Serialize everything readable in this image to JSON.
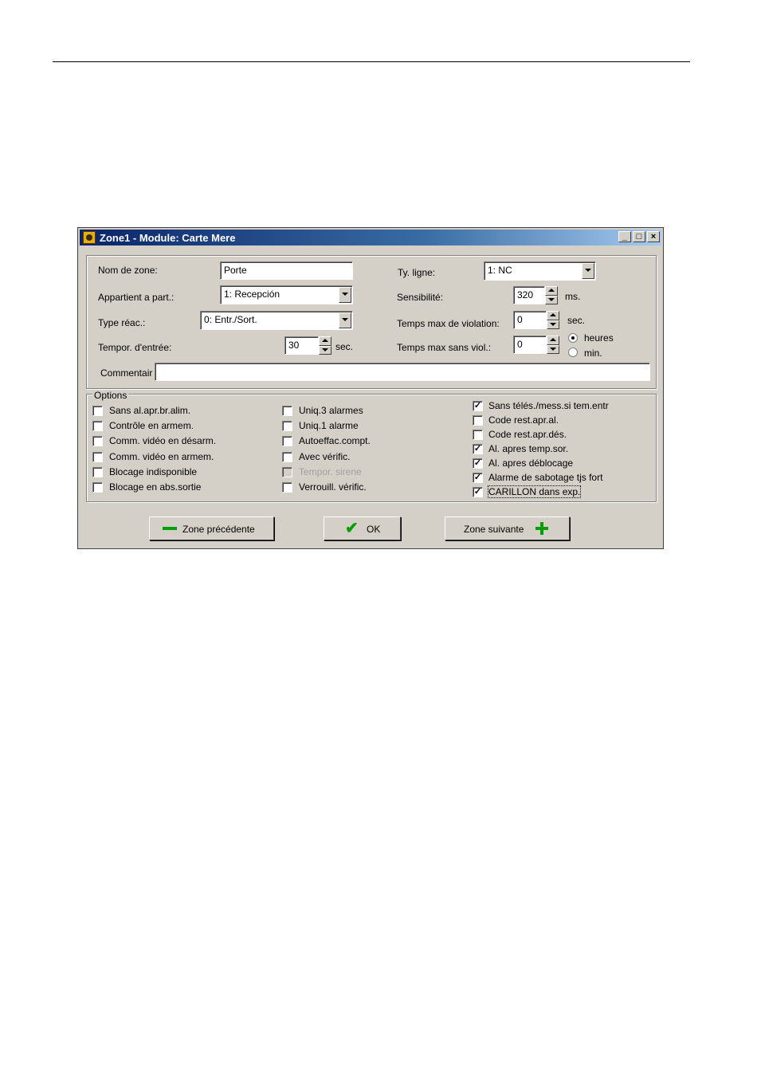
{
  "window": {
    "title": "Zone1 - Module: Carte Mere",
    "controls": {
      "minimize": "_",
      "maximize": "□",
      "close": "×"
    }
  },
  "fields": {
    "nom_de_zone": {
      "label": "Nom de zone:",
      "value": "Porte"
    },
    "appartient": {
      "label": "Appartient a part.:",
      "value": "1: Recepción"
    },
    "type_reac": {
      "label": "Type réac.:",
      "value": "0: Entr./Sort."
    },
    "tempor_entree": {
      "label": "Tempor. d'entrée:",
      "value": "30",
      "unit": "sec."
    },
    "ty_ligne": {
      "label": "Ty. ligne:",
      "value": "1: NC"
    },
    "sensibilite": {
      "label": "Sensibilité:",
      "value": "320",
      "unit": "ms."
    },
    "temps_violation": {
      "label": "Temps max de violation:",
      "value": "0",
      "unit": "sec."
    },
    "temps_sans_viol": {
      "label": "Temps max sans viol.:",
      "value": "0"
    },
    "units_radio": {
      "heures": "heures",
      "min": "min.",
      "selected": "heures"
    },
    "commentaire": {
      "label": "Commentair",
      "value": ""
    }
  },
  "options": {
    "title": "Options",
    "col1": [
      {
        "label": "Sans al.apr.br.alim.",
        "checked": false
      },
      {
        "label": "Contrôle en armem.",
        "checked": false
      },
      {
        "label": "Comm. vidéo en désarm.",
        "checked": false
      },
      {
        "label": "Comm. vidéo en armem.",
        "checked": false
      },
      {
        "label": "Blocage indisponible",
        "checked": false
      },
      {
        "label": "Blocage en abs.sortie",
        "checked": false
      }
    ],
    "col2": [
      {
        "label": "Uniq.3 alarmes",
        "checked": false
      },
      {
        "label": "Uniq.1 alarme",
        "checked": false
      },
      {
        "label": "Autoeffac.compt.",
        "checked": false
      },
      {
        "label": "Avec vérific.",
        "checked": false
      },
      {
        "label": "Tempor. sirene",
        "checked": false,
        "disabled": true
      },
      {
        "label": "Verrouill. vérific.",
        "checked": false
      }
    ],
    "col3": [
      {
        "label": "Sans télés./mess.si tem.entr",
        "checked": true
      },
      {
        "label": "Code rest.apr.al.",
        "checked": false
      },
      {
        "label": "Code rest.apr.dés.",
        "checked": false
      },
      {
        "label": "Al. apres temp.sor.",
        "checked": true
      },
      {
        "label": "Al. apres déblocage",
        "checked": true
      },
      {
        "label": "Alarme de sabotage tjs fort",
        "checked": true
      },
      {
        "label": "CARILLON dans exp.",
        "checked": true
      }
    ]
  },
  "buttons": {
    "prev": "Zone précédente",
    "ok": "OK",
    "next": "Zone suivante"
  }
}
